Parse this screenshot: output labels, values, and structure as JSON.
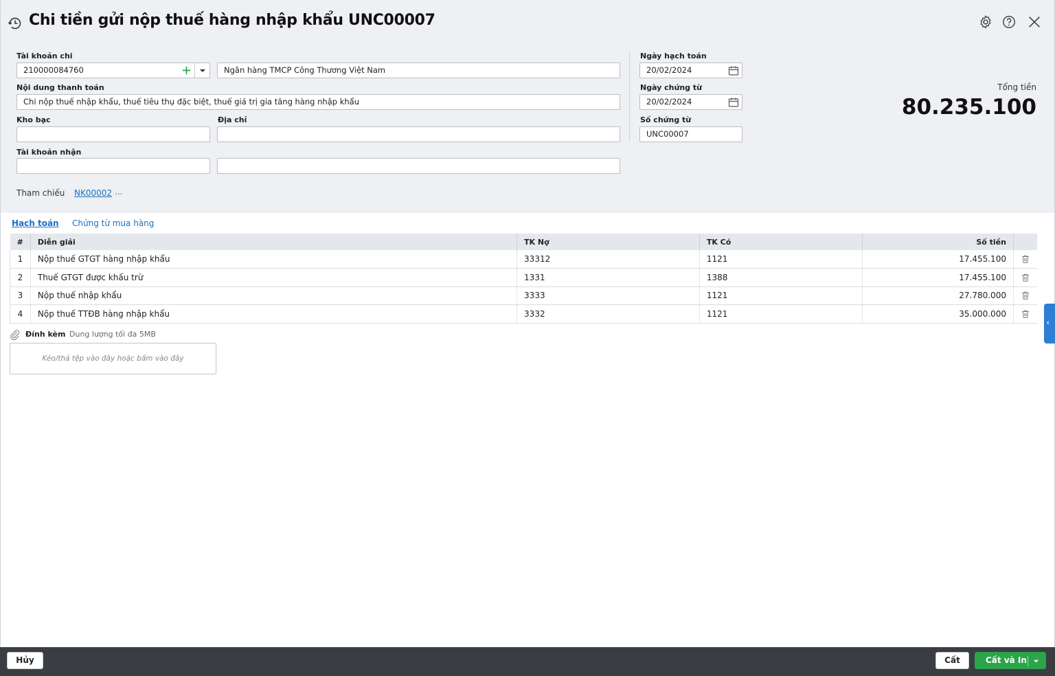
{
  "window": {
    "title": "Chi tiền gửi nộp thuế hàng nhập khẩu UNC00007"
  },
  "form": {
    "tai_khoan_chi": {
      "label": "Tài khoản chi",
      "value": "210000084760",
      "bank_name": "Ngân hàng TMCP Công Thương Việt Nam"
    },
    "noi_dung": {
      "label": "Nội dung thanh toán",
      "value": "Chi nộp thuế nhập khẩu, thuế tiêu thụ đặc biệt, thuế giá trị gia tăng hàng nhập khẩu"
    },
    "kho_bac": {
      "label": "Kho bạc",
      "value": ""
    },
    "dia_chi": {
      "label": "Địa chỉ",
      "value": ""
    },
    "tai_khoan_nhan": {
      "label": "Tài khoản nhận",
      "value": "",
      "name_value": ""
    },
    "ngay_hach_toan": {
      "label": "Ngày hạch toán",
      "value": "20/02/2024"
    },
    "ngay_chung_tu": {
      "label": "Ngày chứng từ",
      "value": "20/02/2024"
    },
    "so_chung_tu": {
      "label": "Số chứng từ",
      "value": "UNC00007"
    },
    "tham_chieu": {
      "label": "Tham chiếu",
      "link": "NK00002",
      "more": "..."
    }
  },
  "total": {
    "label": "Tổng tiền",
    "value": "80.235.100"
  },
  "tabs": [
    {
      "label": "Hạch toán",
      "active": true
    },
    {
      "label": "Chứng từ mua hàng",
      "active": false
    }
  ],
  "table": {
    "columns": [
      "#",
      "Diễn giải",
      "TK Nợ",
      "TK Có",
      "Số tiền"
    ],
    "rows": [
      {
        "no": "1",
        "dien_giai": "Nộp thuế GTGT hàng nhập khẩu",
        "tk_no": "33312",
        "tk_co": "1121",
        "so_tien": "17.455.100"
      },
      {
        "no": "2",
        "dien_giai": "Thuế GTGT được khấu trừ",
        "tk_no": "1331",
        "tk_co": "1388",
        "so_tien": "17.455.100"
      },
      {
        "no": "3",
        "dien_giai": "Nộp thuế nhập khẩu",
        "tk_no": "3333",
        "tk_co": "1121",
        "so_tien": "27.780.000"
      },
      {
        "no": "4",
        "dien_giai": "Nộp thuế TTĐB hàng nhập khẩu",
        "tk_no": "3332",
        "tk_co": "1121",
        "so_tien": "35.000.000"
      }
    ]
  },
  "attachment": {
    "label": "Đính kèm",
    "note": "Dung lượng tối đa 5MB",
    "dropzone": "Kéo/thả tệp vào đây hoặc bấm vào đây"
  },
  "footer": {
    "cancel": "Hủy",
    "save": "Cất",
    "save_print": "Cất và In"
  },
  "icons": {
    "title": "history-icon",
    "settings": "gear-icon",
    "help": "help-icon",
    "close": "close-icon",
    "add": "plus-icon",
    "dropdown": "caret-down-icon",
    "calendar": "calendar-icon",
    "delete": "trash-icon",
    "attach": "paperclip-icon",
    "side": "chevron-left-icon"
  },
  "colors": {
    "header_bg": "#eef0f3",
    "link": "#1a6fc2",
    "primary_green": "#2ca44a",
    "footer_bg": "#3a3d42",
    "add_green": "#2ca44a"
  }
}
